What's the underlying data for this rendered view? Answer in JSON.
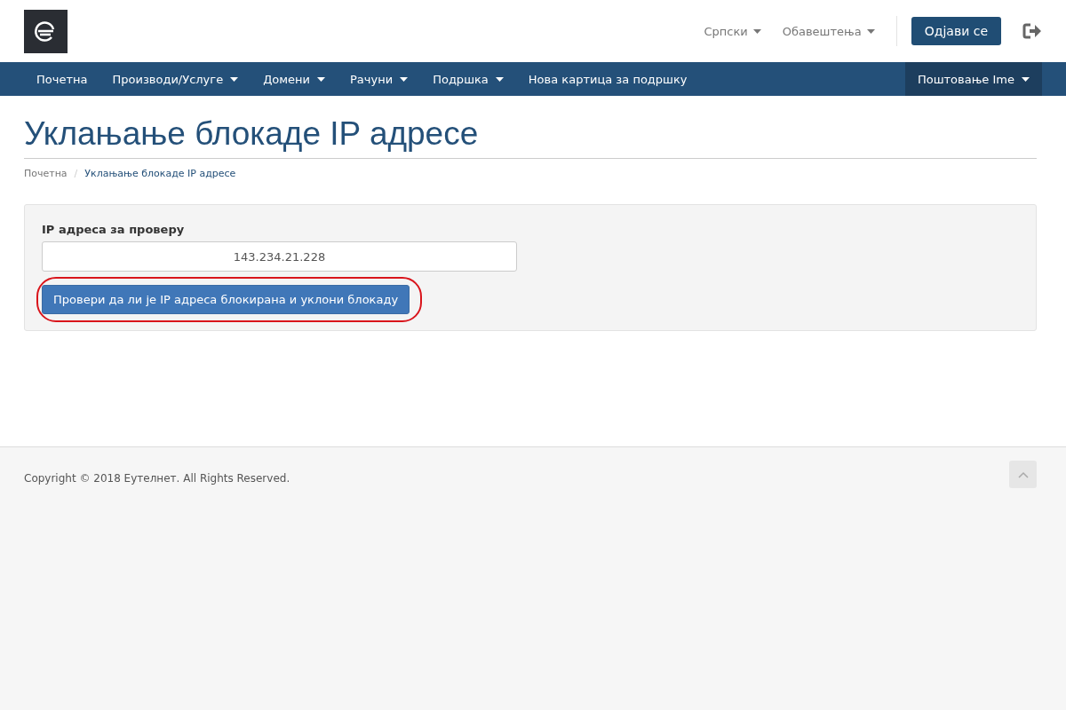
{
  "header": {
    "language": {
      "label": "Српски",
      "dropdown": true
    },
    "notifications": {
      "label": "Обавештења",
      "dropdown": true
    },
    "logout_button": "Одјави се"
  },
  "nav": {
    "items": [
      {
        "label": "Почетна",
        "dropdown": false
      },
      {
        "label": "Производи/Услуге",
        "dropdown": true
      },
      {
        "label": "Домени",
        "dropdown": true
      },
      {
        "label": "Рачуни",
        "dropdown": true
      },
      {
        "label": "Подршка",
        "dropdown": true
      },
      {
        "label": "Нова картица за подршку",
        "dropdown": false
      }
    ],
    "account": {
      "label": "Поштовање Ime",
      "dropdown": true
    }
  },
  "page": {
    "title": "Уклањање блокаде IP адресе",
    "breadcrumb_separator": "/",
    "breadcrumb": [
      {
        "label": "Почетна",
        "selected": false
      },
      {
        "label": "Уклањање блокаде IP адресе",
        "selected": true
      }
    ]
  },
  "form": {
    "label": "IP адреса за проверу",
    "ip_value": "143.234.21.228",
    "submit": {
      "label": "Провери да ли је IP адреса блокирана и уклони блокаду",
      "highlighted": true
    }
  },
  "footer": {
    "copyright": "Copyright © 2018 Еутелнет. All Rights Reserved."
  }
}
